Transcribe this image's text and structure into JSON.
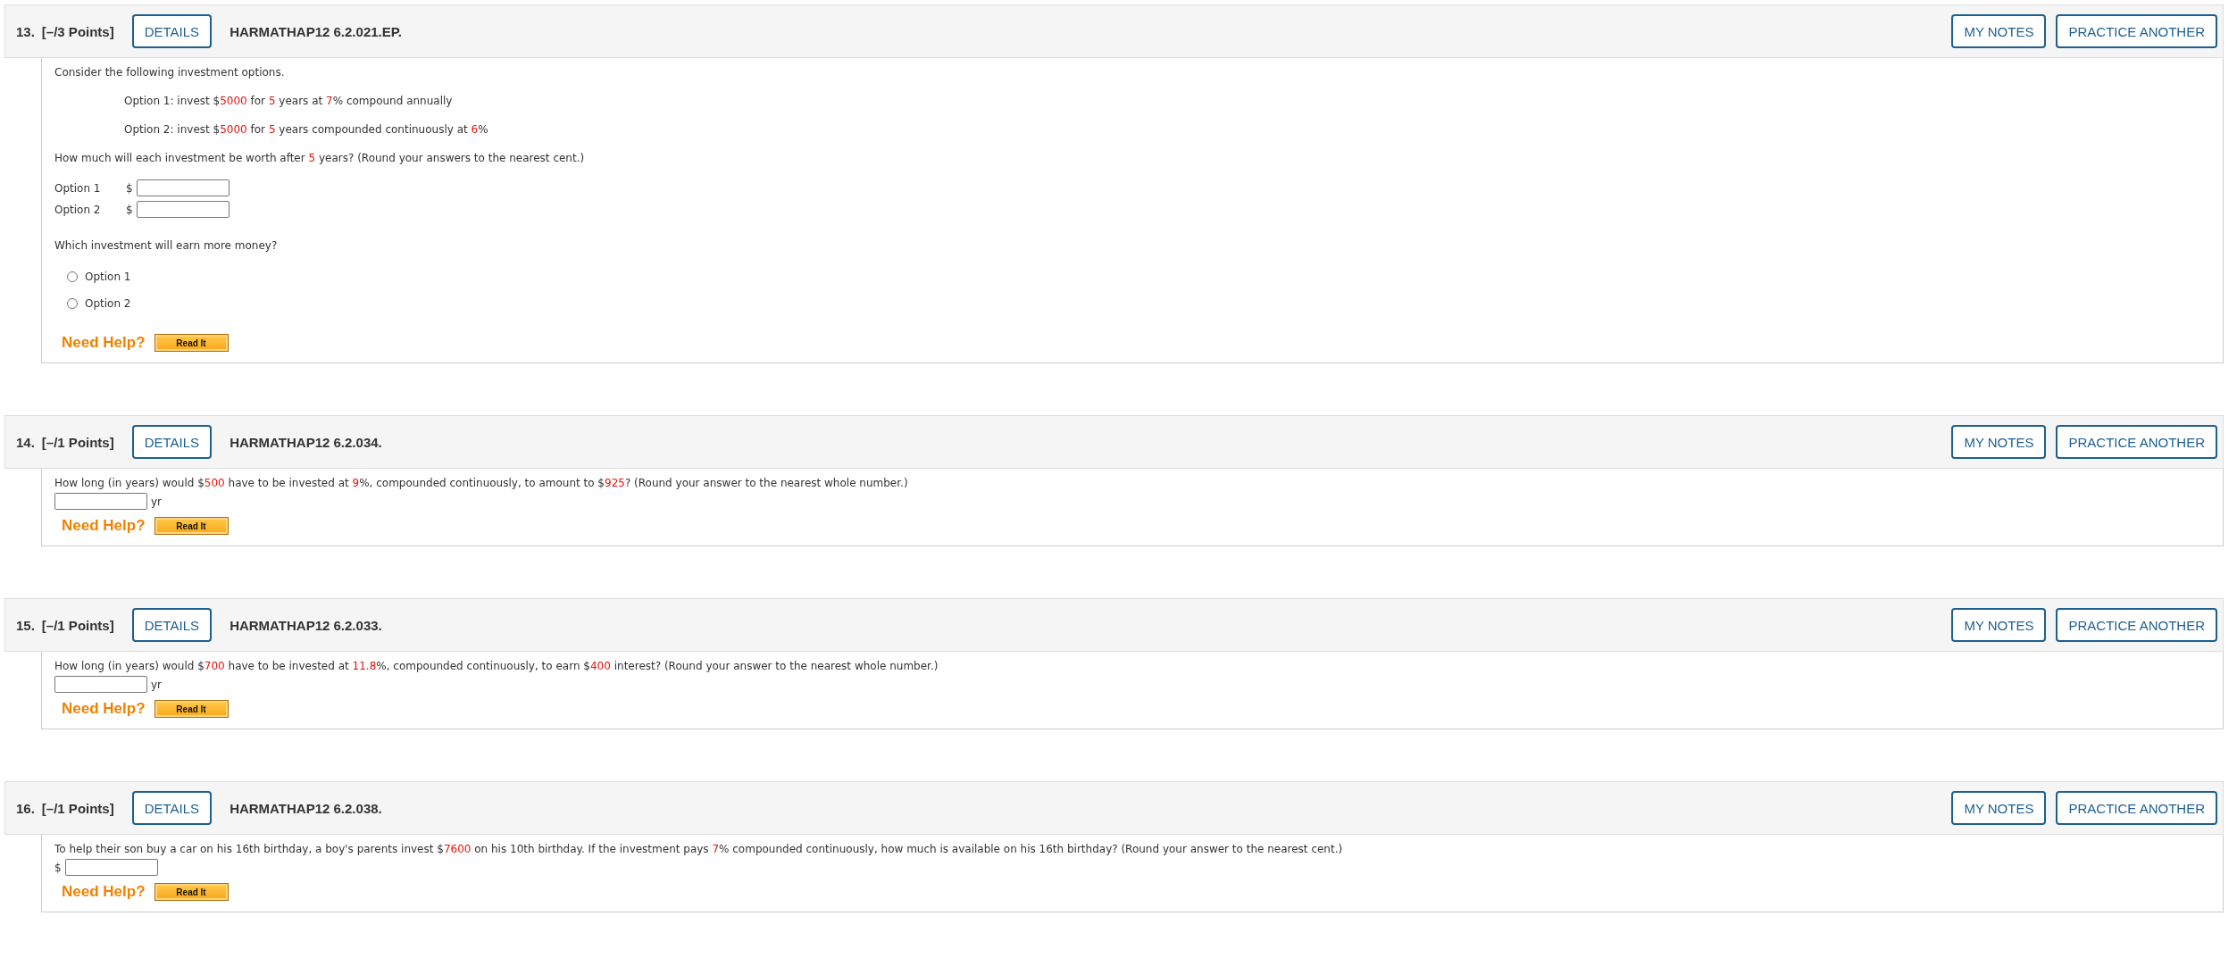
{
  "questions": [
    {
      "number": "13.",
      "points": "[–/3 Points]",
      "details": "DETAILS",
      "code": "HARMATHAP12 6.2.021.EP.",
      "my_notes": "MY NOTES",
      "practice": "PRACTICE ANOTHER",
      "need_help": "Need Help?",
      "read_it": "Read It",
      "blocks": [
        {
          "kind": "text",
          "segments": [
            {
              "t": "Consider the following investment options.",
              "red": false
            }
          ]
        },
        {
          "kind": "indented",
          "segments": [
            {
              "t": "Option 1: invest $",
              "red": false
            },
            {
              "t": "5000",
              "red": true
            },
            {
              "t": " for ",
              "red": false
            },
            {
              "t": "5",
              "red": true
            },
            {
              "t": " years at ",
              "red": false
            },
            {
              "t": "7",
              "red": true
            },
            {
              "t": "% compound annually",
              "red": false
            }
          ]
        },
        {
          "kind": "indented",
          "segments": [
            {
              "t": "Option 2: invest $",
              "red": false
            },
            {
              "t": "5000",
              "red": true
            },
            {
              "t": " for ",
              "red": false
            },
            {
              "t": "5",
              "red": true
            },
            {
              "t": " years compounded continuously at ",
              "red": false
            },
            {
              "t": "6",
              "red": true
            },
            {
              "t": "%",
              "red": false
            }
          ]
        },
        {
          "kind": "text",
          "segments": [
            {
              "t": "How much will each investment be worth after ",
              "red": false
            },
            {
              "t": "5",
              "red": true
            },
            {
              "t": " years? (Round your answers to the nearest cent.)",
              "red": false
            }
          ]
        },
        {
          "kind": "answer",
          "label": "Option 1",
          "prefix": "$"
        },
        {
          "kind": "answer",
          "label": "Option 2",
          "prefix": "$"
        },
        {
          "kind": "text",
          "segments": [
            {
              "t": "Which investment will earn more money?",
              "red": false
            }
          ]
        },
        {
          "kind": "radio",
          "label": "Option 1",
          "selected": false
        },
        {
          "kind": "radio",
          "label": "Option 2",
          "selected": false
        }
      ]
    },
    {
      "number": "14.",
      "points": "[–/1 Points]",
      "details": "DETAILS",
      "code": "HARMATHAP12 6.2.034.",
      "my_notes": "MY NOTES",
      "practice": "PRACTICE ANOTHER",
      "need_help": "Need Help?",
      "read_it": "Read It",
      "blocks": [
        {
          "kind": "compact",
          "segments": [
            {
              "t": "How long (in years) would $",
              "red": false
            },
            {
              "t": "500",
              "red": true
            },
            {
              "t": " have to be invested at ",
              "red": false
            },
            {
              "t": "9",
              "red": true
            },
            {
              "t": "%, compounded continuously, to amount to $",
              "red": false
            },
            {
              "t": "925",
              "red": true
            },
            {
              "t": "? (Round your answer to the nearest whole number.)",
              "red": false
            }
          ]
        },
        {
          "kind": "answer",
          "suffix": "yr"
        }
      ]
    },
    {
      "number": "15.",
      "points": "[–/1 Points]",
      "details": "DETAILS",
      "code": "HARMATHAP12 6.2.033.",
      "my_notes": "MY NOTES",
      "practice": "PRACTICE ANOTHER",
      "need_help": "Need Help?",
      "read_it": "Read It",
      "blocks": [
        {
          "kind": "compact",
          "segments": [
            {
              "t": "How long (in years) would $",
              "red": false
            },
            {
              "t": "700",
              "red": true
            },
            {
              "t": " have to be invested at ",
              "red": false
            },
            {
              "t": "11.8",
              "red": true
            },
            {
              "t": "%, compounded continuously, to earn $",
              "red": false
            },
            {
              "t": "400",
              "red": true
            },
            {
              "t": " interest? (Round your answer to the nearest whole number.)",
              "red": false
            }
          ]
        },
        {
          "kind": "answer",
          "suffix": "yr"
        }
      ]
    },
    {
      "number": "16.",
      "points": "[–/1 Points]",
      "details": "DETAILS",
      "code": "HARMATHAP12 6.2.038.",
      "my_notes": "MY NOTES",
      "practice": "PRACTICE ANOTHER",
      "need_help": "Need Help?",
      "read_it": "Read It",
      "blocks": [
        {
          "kind": "compact",
          "segments": [
            {
              "t": "To help their son buy a car on his 16th birthday, a boy's parents invest $",
              "red": false
            },
            {
              "t": "7600",
              "red": true
            },
            {
              "t": " on his 10th birthday. If the investment pays ",
              "red": false
            },
            {
              "t": "7",
              "red": true
            },
            {
              "t": "% compounded continuously, how much is available on his 16th birthday? (Round your answer to the nearest cent.)",
              "red": false
            }
          ]
        },
        {
          "kind": "answer",
          "prefix": "$"
        }
      ]
    }
  ]
}
